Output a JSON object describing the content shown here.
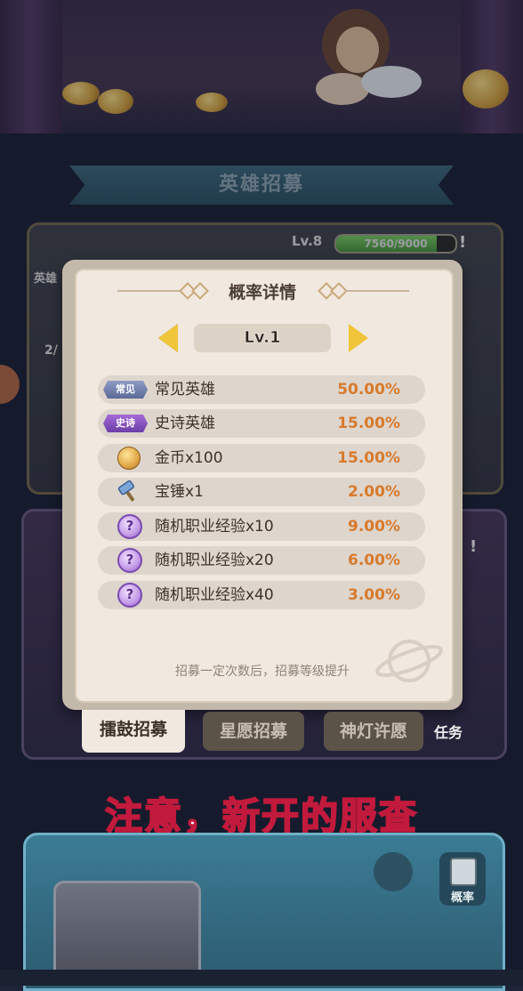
{
  "background": {
    "banner_title": "英雄招募",
    "level_label": "Lv.8",
    "exp_text": "7560/9000",
    "exp_fraction": 0.84,
    "side_hero_label": "英雄",
    "side_count": "2/",
    "warning_mark": "!",
    "task_label": "任务"
  },
  "modal": {
    "title": "概率详情",
    "level": "Lv.1",
    "rows": [
      {
        "badge": "常见",
        "name": "常见英雄",
        "pct": "50.00%",
        "icon": "common-badge"
      },
      {
        "badge": "史诗",
        "name": "史诗英雄",
        "pct": "15.00%",
        "icon": "epic-badge"
      },
      {
        "badge": "",
        "name": "金币x100",
        "pct": "15.00%",
        "icon": "coin-icon"
      },
      {
        "badge": "",
        "name": "宝锤x1",
        "pct": "2.00%",
        "icon": "hammer-icon"
      },
      {
        "badge": "",
        "name": "随机职业经验x10",
        "pct": "9.00%",
        "icon": "question-orb-icon"
      },
      {
        "badge": "",
        "name": "随机职业经验x20",
        "pct": "6.00%",
        "icon": "question-orb-icon"
      },
      {
        "badge": "",
        "name": "随机职业经验x40",
        "pct": "3.00%",
        "icon": "question-orb-icon"
      }
    ],
    "note": "招募一定次数后，招募等级提升"
  },
  "tabs": [
    "擂鼓招募",
    "星愿招募",
    "神灯许愿"
  ],
  "subtitle": "注意，新开的服查",
  "bottom": {
    "prob_label": "概率"
  },
  "colors": {
    "accent_orange": "#d77a2c",
    "subtitle_stroke": "#c21a3c",
    "arrow_yellow": "#f0c53a"
  }
}
